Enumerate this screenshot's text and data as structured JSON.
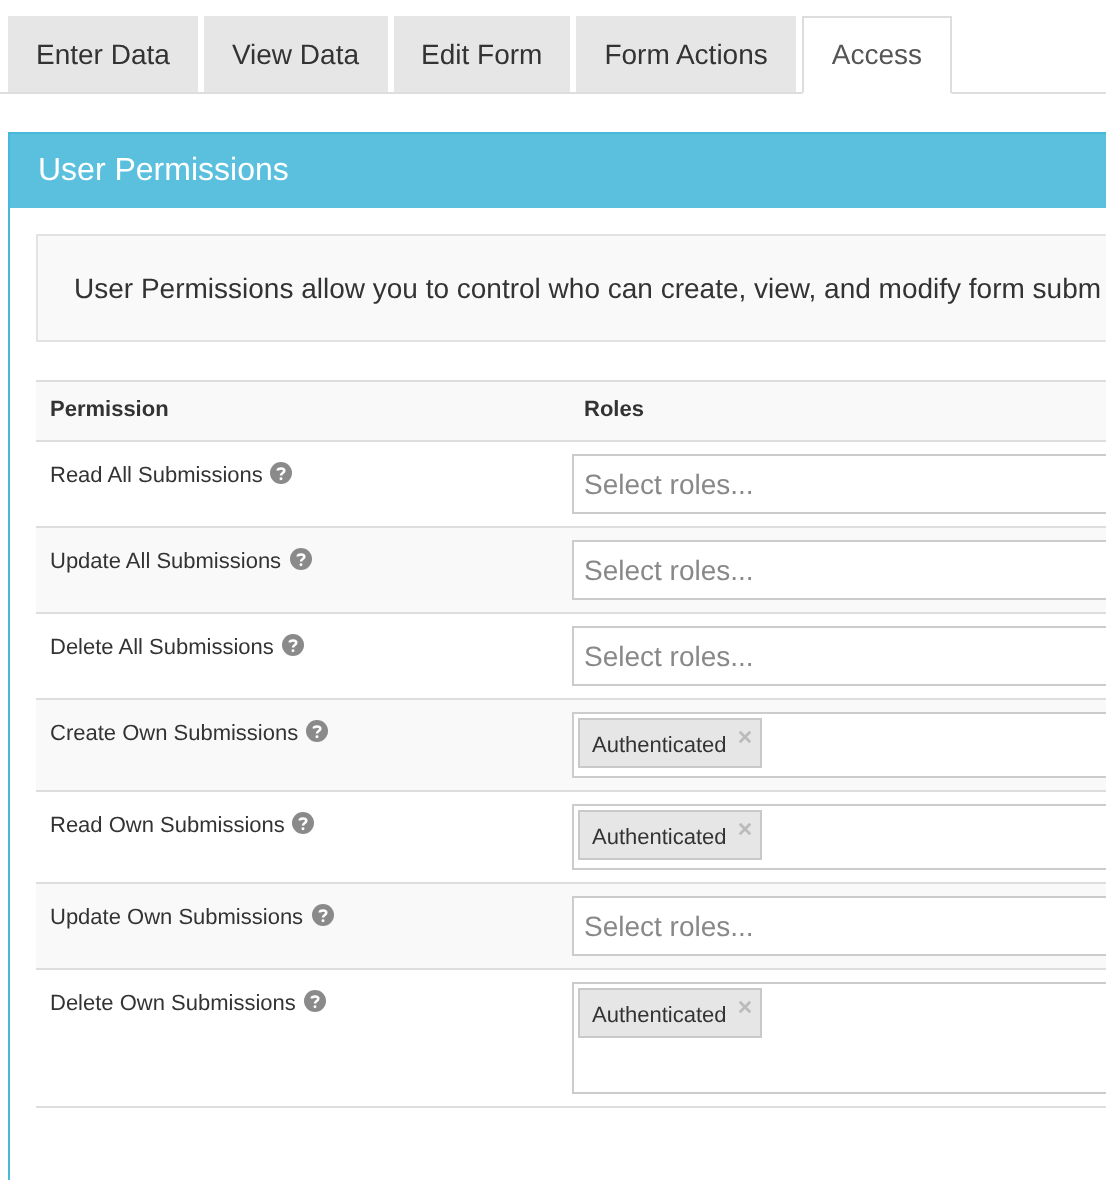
{
  "tabs": [
    {
      "label": "Enter Data",
      "selected": false
    },
    {
      "label": "View Data",
      "selected": false
    },
    {
      "label": "Edit Form",
      "selected": false
    },
    {
      "label": "Form Actions",
      "selected": false
    },
    {
      "label": "Access",
      "selected": true
    }
  ],
  "panel": {
    "title": "User Permissions",
    "intro": "User Permissions allow you to control who can create, view, and modify form subm"
  },
  "table": {
    "columns": [
      "Permission",
      "Roles"
    ],
    "rows": [
      {
        "permission": "Read All Submissions",
        "placeholder": "Select roles...",
        "roles": []
      },
      {
        "permission": "Update All Submissions",
        "placeholder": "Select roles...",
        "roles": []
      },
      {
        "permission": "Delete All Submissions",
        "placeholder": "Select roles...",
        "roles": []
      },
      {
        "permission": "Create Own Submissions",
        "roles": [
          {
            "label": "Authenticated"
          }
        ]
      },
      {
        "permission": "Read Own Submissions",
        "roles": [
          {
            "label": "Authenticated"
          }
        ]
      },
      {
        "permission": "Update Own Submissions",
        "placeholder": "Select roles...",
        "roles": []
      },
      {
        "permission": "Delete Own Submissions",
        "roles": [
          {
            "label": "Authenticated"
          }
        ],
        "tall": true
      }
    ]
  }
}
